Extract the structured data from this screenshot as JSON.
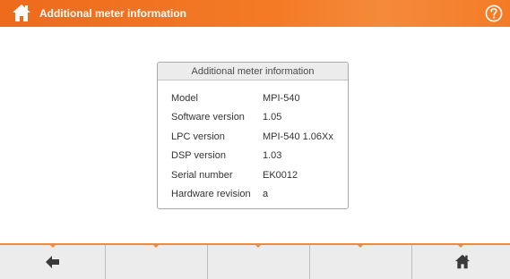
{
  "header": {
    "title": "Additional meter information",
    "home_icon": "home-icon",
    "help_icon": "help-icon",
    "accent_color": "#f47b26"
  },
  "panel": {
    "title": "Additional meter information",
    "rows": [
      {
        "label": "Model",
        "value": "MPI-540"
      },
      {
        "label": "Software version",
        "value": "1.05"
      },
      {
        "label": "LPC version",
        "value": "MPI-540 1.06Xx"
      },
      {
        "label": "DSP version",
        "value": "1.03"
      },
      {
        "label": "Serial number",
        "value": "EK0012"
      },
      {
        "label": "Hardware revision",
        "value": "a"
      }
    ]
  },
  "bottom_bar": {
    "buttons": [
      {
        "name": "back-button",
        "icon": "arrow-left-icon"
      },
      {
        "name": "empty-button-2",
        "icon": ""
      },
      {
        "name": "empty-button-3",
        "icon": ""
      },
      {
        "name": "empty-button-4",
        "icon": ""
      },
      {
        "name": "home-button",
        "icon": "home-icon"
      }
    ]
  }
}
